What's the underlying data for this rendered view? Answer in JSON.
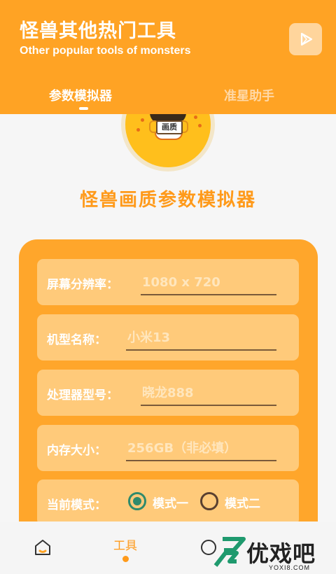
{
  "header": {
    "title": "怪兽其他热门工具",
    "subtitle": "Other popular tools of monsters",
    "play_icon": "play-icon"
  },
  "tabs": [
    {
      "label": "参数模拟器",
      "active": true
    },
    {
      "label": "准星助手",
      "active": false
    }
  ],
  "logo": {
    "badge_text": "画质"
  },
  "main_title": "怪兽画质参数模拟器",
  "form": {
    "resolution": {
      "label": "屏幕分辨率：",
      "placeholder": "1080 x 720"
    },
    "model": {
      "label": "机型名称：",
      "placeholder": "小米13"
    },
    "processor": {
      "label": "处理器型号：",
      "placeholder": "晓龙888"
    },
    "memory": {
      "label": "内存大小：",
      "placeholder": "256GB（非必填）"
    },
    "mode": {
      "label": "当前模式：",
      "options": [
        {
          "label": "模式一",
          "checked": true
        },
        {
          "label": "模式二",
          "checked": false
        }
      ]
    }
  },
  "bottom_nav": {
    "tools_label": "工具"
  },
  "watermark": {
    "text": "优戏吧",
    "url": "YOXI8.COM"
  },
  "colors": {
    "accent": "#ffa324",
    "panel": "#ffa62b",
    "field": "#ffca7a",
    "radio_checked": "#2f8a6c"
  }
}
